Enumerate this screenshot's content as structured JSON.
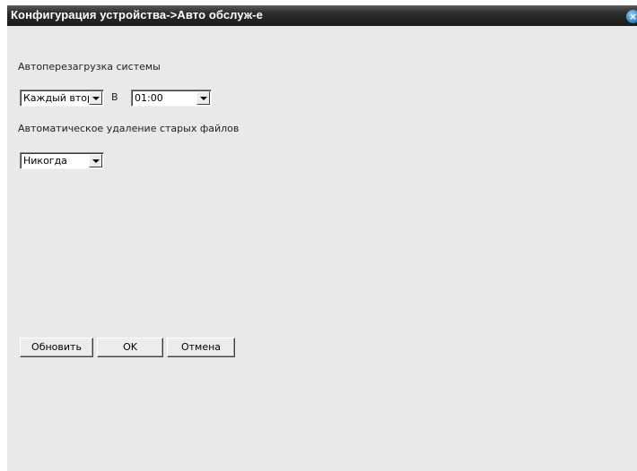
{
  "window": {
    "title": "Конфигурация устройства->Авто обслуж-е",
    "close_icon": "close-icon"
  },
  "auto_reboot": {
    "label": "Автоперезагрузка системы",
    "day_value": "Каждый втор",
    "at_label": "В",
    "time_value": "01:00"
  },
  "auto_delete": {
    "label": "Автоматическое удаление старых файлов",
    "value": "Никогда"
  },
  "buttons": {
    "refresh": "Обновить",
    "ok": "OK",
    "cancel": "Отмена"
  },
  "colors": {
    "panel_bg": "#e9e9e9",
    "titlebar": "#1a1a1a",
    "close_accent": "#2b7fc4"
  }
}
